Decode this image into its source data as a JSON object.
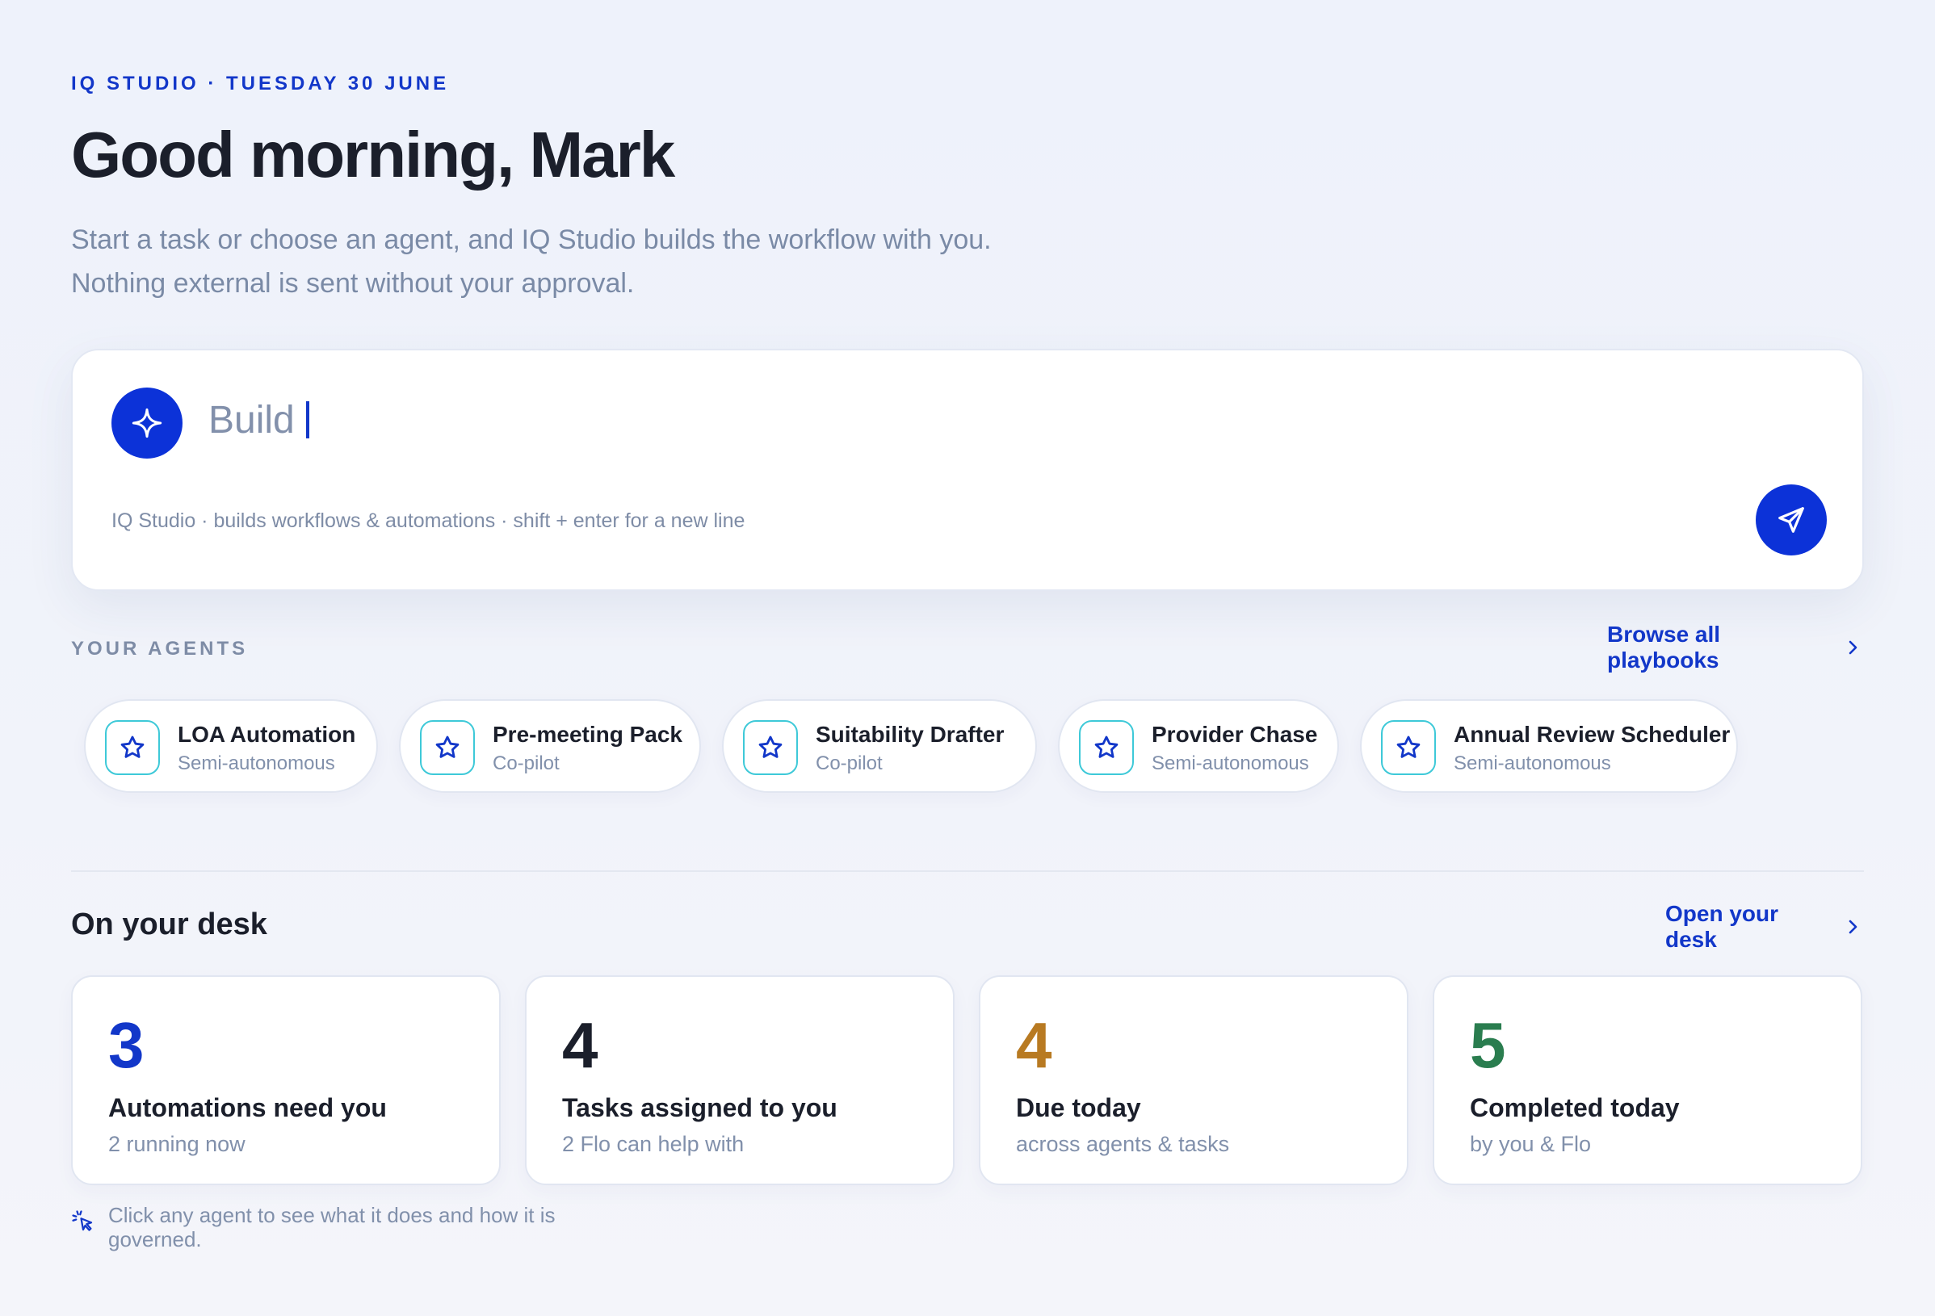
{
  "header": {
    "eyebrow": "IQ STUDIO · TUESDAY 30 JUNE",
    "greeting": "Good morning, Mark",
    "subtitle_line1": "Start a task or choose an agent, and IQ Studio builds the workflow with you.",
    "subtitle_line2": "Nothing external is sent without your approval."
  },
  "composer": {
    "value": "Build",
    "hint": "IQ Studio · builds workflows & automations · shift + enter for a new line",
    "spark_icon": "sparkle-icon",
    "send_icon": "send-icon"
  },
  "agents_section": {
    "label": "YOUR AGENTS",
    "link": "Browse all playbooks",
    "items": [
      {
        "name": "LOA Automation",
        "mode": "Semi-autonomous"
      },
      {
        "name": "Pre-meeting Pack",
        "mode": "Co-pilot"
      },
      {
        "name": "Suitability Drafter",
        "mode": "Co-pilot"
      },
      {
        "name": "Provider Chase",
        "mode": "Semi-autonomous"
      },
      {
        "name": "Annual Review Scheduler",
        "mode": "Semi-autonomous"
      }
    ]
  },
  "desk": {
    "title": "On your desk",
    "link": "Open your desk",
    "stats": [
      {
        "value": "3",
        "label": "Automations need you",
        "sub": "2 running now",
        "color": "#1237c9"
      },
      {
        "value": "4",
        "label": "Tasks assigned to you",
        "sub": "2 Flo can help with",
        "color": "#1b1f2b"
      },
      {
        "value": "4",
        "label": "Due today",
        "sub": "across agents & tasks",
        "color": "#b87a22"
      },
      {
        "value": "5",
        "label": "Completed today",
        "sub": "by you & Flo",
        "color": "#2a7d4f"
      }
    ]
  },
  "footnote": "Click any agent to see what it does and how it is governed.",
  "colors": {
    "accent": "#0c32d8",
    "agent_icon_border": "#3ec9d8"
  }
}
